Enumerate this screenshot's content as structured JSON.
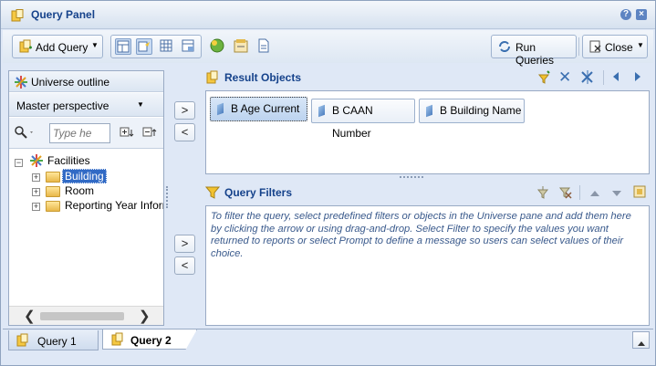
{
  "window": {
    "title": "Query Panel"
  },
  "toolbar": {
    "add_query": "Add Query",
    "run_queries": "Run Queries",
    "close": "Close"
  },
  "universe": {
    "title": "Universe outline",
    "perspective": "Master perspective",
    "search_placeholder": "Type he",
    "root": "Facilities",
    "items": [
      "Building",
      "Room",
      "Reporting Year Inform"
    ]
  },
  "result_objects": {
    "title": "Result Objects",
    "objects": [
      "B Age Current",
      "B CAAN Number",
      "B Building Name"
    ]
  },
  "query_filters": {
    "title": "Query Filters",
    "help": "To filter the query, select predefined filters or objects in the Universe pane and add them here by clicking the arrow or using drag-and-drop. Select Filter to specify the values you want returned to reports or select Prompt to define a message so users can select values of their choice."
  },
  "arrows": {
    "add": ">",
    "remove": "<"
  },
  "tabs": [
    "Query 1",
    "Query 2"
  ],
  "colors": {
    "accent": "#15428b",
    "selected": "#316ac5",
    "help_text": "#3a5a8c"
  }
}
